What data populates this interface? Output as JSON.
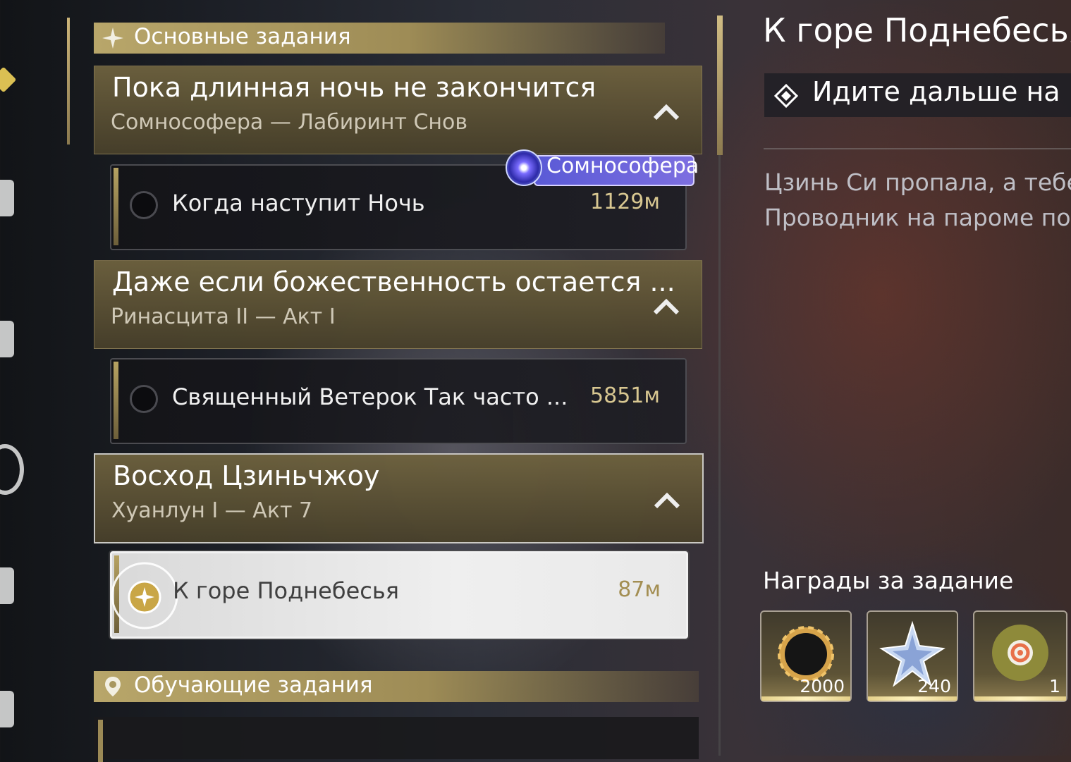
{
  "sections": {
    "main": {
      "label": "Основные задания"
    },
    "tutorial": {
      "label": "Обучающие задания"
    }
  },
  "groups": [
    {
      "title": "Пока длинная ночь не закончится",
      "subtitle": "Сомнософера — Лабиринт Снов",
      "task": {
        "name": "Когда наступит Ночь",
        "distance": "1129м"
      },
      "badge": "Сомнософера"
    },
    {
      "title": "Даже если божественность остается ...",
      "subtitle": "Ринасцита II — Акт I",
      "task": {
        "name": "Священный Ветерок Так часто ...",
        "distance": "5851м"
      }
    },
    {
      "title": "Восход Цзиньчжоу",
      "subtitle": "Хуанлун I — Акт 7",
      "task": {
        "name": "К горе Поднебесья",
        "distance": "87м"
      }
    }
  ],
  "detail": {
    "title": "К горе Поднебесья",
    "objective": "Идите дальше на го",
    "description_line1": "Цзинь Си пропала, а тебе",
    "description_line2": "Проводник на пароме по",
    "rewards_title": "Награды за задание",
    "rewards": [
      {
        "icon": "shell-credit-icon",
        "count": "2000"
      },
      {
        "icon": "exp-star-icon",
        "count": "240"
      },
      {
        "icon": "echo-orb-icon",
        "count": "1"
      }
    ]
  },
  "colors": {
    "accent_gold": "#b8a66a",
    "distance_gold": "#d8c791",
    "badge_purple": "#6a62dc"
  }
}
